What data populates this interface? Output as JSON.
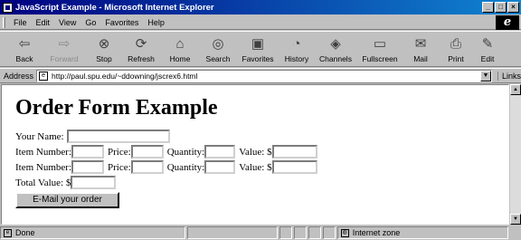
{
  "window": {
    "title": "JavaScript Example - Microsoft Internet Explorer",
    "buttons": [
      "_",
      "□",
      "×"
    ]
  },
  "menu": [
    {
      "label": "File"
    },
    {
      "label": "Edit"
    },
    {
      "label": "View"
    },
    {
      "label": "Go"
    },
    {
      "label": "Favorites"
    },
    {
      "label": "Help"
    }
  ],
  "toolbar": {
    "back": "Back",
    "forward": "Forward",
    "stop": "Stop",
    "refresh": "Refresh",
    "home": "Home",
    "search": "Search",
    "favorites": "Favorites",
    "history": "History",
    "channels": "Channels",
    "fullscreen": "Fullscreen",
    "mail": "Mail",
    "print": "Print",
    "edit": "Edit"
  },
  "address": {
    "label": "Address",
    "url": "http://paul.spu.edu/~ddowning/jscrex6.html",
    "links": "Links"
  },
  "page": {
    "heading": "Order Form Example",
    "your_name_label": "Your Name:",
    "item_number_label": "Item Number:",
    "price_label": "Price:",
    "quantity_label": "Quantity:",
    "value_label": "Value: $",
    "total_value_label": "Total Value: $",
    "submit_label": "E-Mail your order"
  },
  "status": {
    "text": "Done",
    "zone": "Internet zone"
  }
}
